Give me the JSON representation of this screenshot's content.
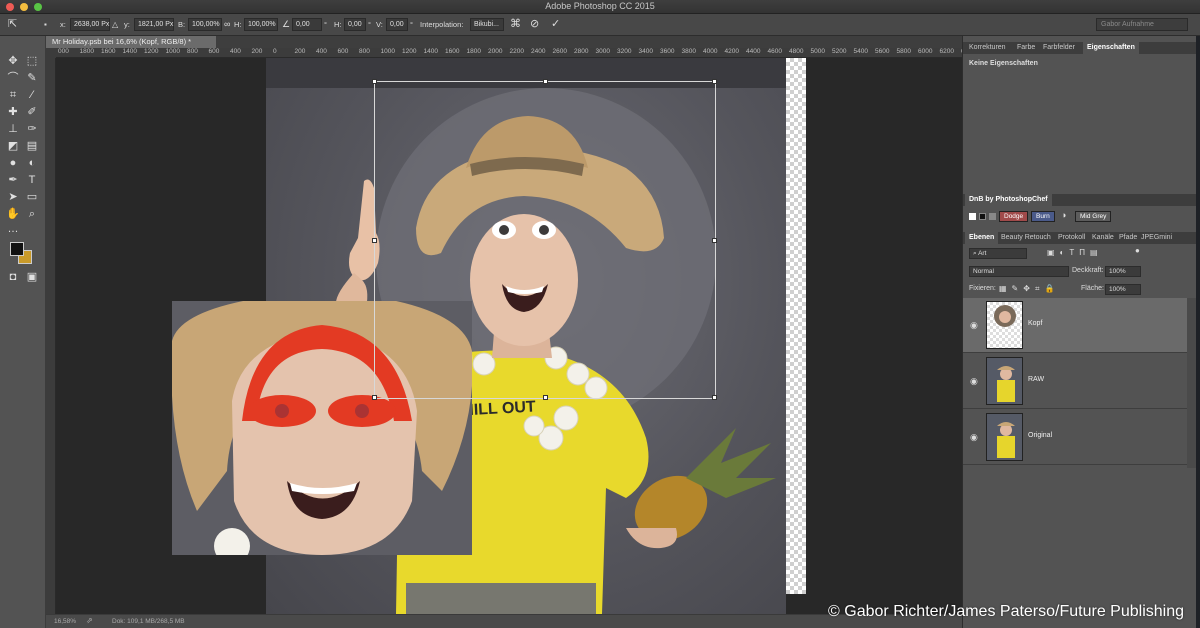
{
  "window": {
    "title": "Adobe Photoshop CC 2015"
  },
  "options": {
    "x_label": "x:",
    "x_value": "2638,00 Px",
    "y_label": "y:",
    "y_value": "1821,00 Px",
    "w_label": "B:",
    "w_value": "100,00%",
    "h_label": "H:",
    "h_value": "100,00%",
    "angle_value": "0,00",
    "angle_unit": "°",
    "hskew_label": "H:",
    "hskew_value": "0,00",
    "hskew_unit": "°",
    "vskew_label": "V:",
    "vskew_value": "0,00",
    "vskew_unit": "°",
    "interp_label": "Interpolation:",
    "interp_value": "Bikubi...",
    "workspace": "Gabor Aufnahme"
  },
  "document": {
    "tab_title": "Mr Holiday.psb bei 16,6% (Kopf, RGB/8) *",
    "ruler_labels": [
      "000",
      "1800",
      "1600",
      "1400",
      "1200",
      "1000",
      "800",
      "600",
      "400",
      "200",
      "0",
      "200",
      "400",
      "600",
      "800",
      "1000",
      "1200",
      "1400",
      "1600",
      "1800",
      "2000",
      "2200",
      "2400",
      "2600",
      "2800",
      "3000",
      "3200",
      "3400",
      "3600",
      "3800",
      "4000",
      "4200",
      "4400",
      "4600",
      "4800",
      "5000",
      "5200",
      "5400",
      "5600",
      "5800",
      "6000",
      "6200",
      "64"
    ],
    "zoom": "16,58%",
    "doc_info": "Dok: 109,1 MB/268,5 MB"
  },
  "panels": {
    "top_tabs": [
      "Korrekturen",
      "Farbe",
      "Farbfelder",
      "Eigenschaften"
    ],
    "properties_empty": "Keine Eigenschaften",
    "dnb_title": "DnB by PhotoshopChef",
    "dnb_buttons": {
      "dodge": "Dodge",
      "burn": "Burn",
      "midgrey": "Mid Grey"
    },
    "layer_tabs": [
      "Ebenen",
      "Beauty Retouch",
      "Protokoll",
      "Kanäle",
      "Pfade",
      "JPEGmini"
    ],
    "filter_kind": "Art",
    "blend_mode": "Normal",
    "opacity_label": "Deckkraft:",
    "opacity_value": "100%",
    "lock_label": "Fixieren:",
    "fill_label": "Fläche:",
    "fill_value": "100%",
    "layers": [
      {
        "name": "Kopf"
      },
      {
        "name": "RAW"
      },
      {
        "name": "Original"
      }
    ]
  },
  "credit": "© Gabor Richter/James Paterso/Future Publishing"
}
